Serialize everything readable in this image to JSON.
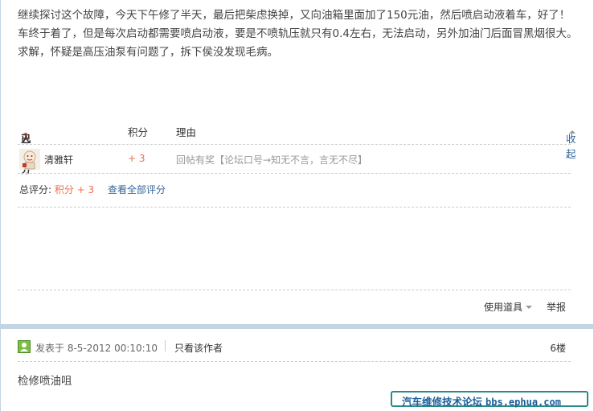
{
  "post": {
    "content": "继续探讨这个故障，今天下午修了半天，最后把柴虑换掉，又向油箱里面加了150元油，然后喷启动液着车，好了！车终于着了，但是每次启动都需要喷启动液，要是不喷轨压就只有0.4左右，无法启动，另外加油门后面冒黑烟很大。求解，怀疑是高压油泵有问题了，拆下侯没发现毛病。"
  },
  "rating": {
    "header_prefix": "已有",
    "header_count": "1",
    "header_suffix": "人评分",
    "col_score": "积分",
    "col_reason": "理由",
    "collapse_label": "收起",
    "rows": [
      {
        "user": "清雅轩",
        "score": "+ 3",
        "reason": "回帖有奖【论坛口号→知无不言，言无不尽】"
      }
    ],
    "total_label": "总评分:",
    "total_value": "积分 + 3",
    "view_all": "查看全部评分"
  },
  "actions": {
    "tools_label": "使用道具",
    "report_label": "举报"
  },
  "post2": {
    "date": "发表于 8-5-2012 00:10:10",
    "only_author": "只看该作者",
    "floor": "6楼",
    "content": "检修喷油咀"
  },
  "watermark": {
    "name": "汽车维修技术论坛",
    "url": "bbs.ephua.com"
  },
  "colors": {
    "accent_orange": "#f26c4f",
    "link_blue": "#336699",
    "divider": "#c2d5e3"
  }
}
